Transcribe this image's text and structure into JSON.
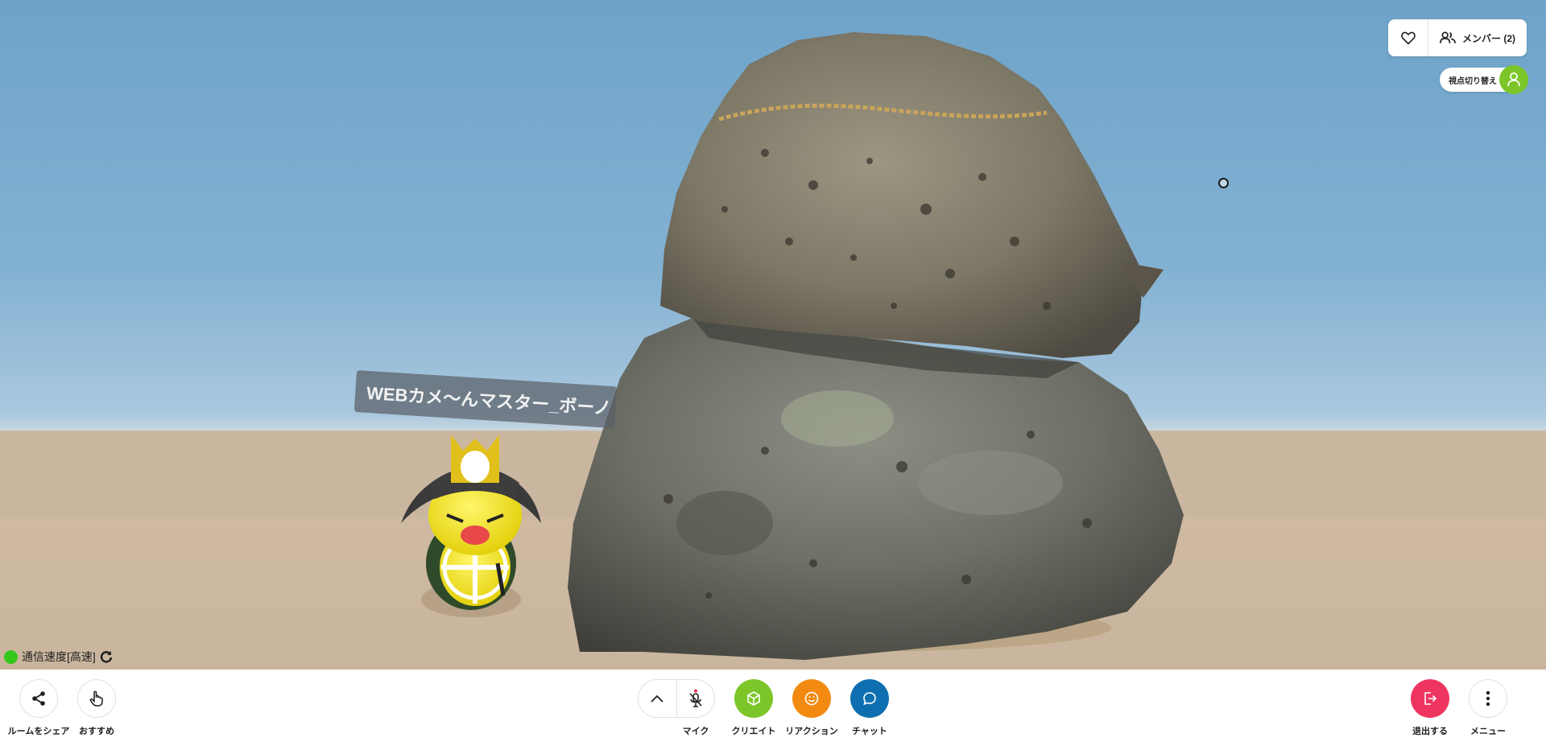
{
  "header": {
    "like_icon": "heart-icon",
    "members_label": "メンバー (2)",
    "members_icon": "users-icon",
    "view_switch_label": "視点切り替え",
    "view_switch_icon": "person-icon",
    "view_switch_color": "#7cc62a"
  },
  "scene": {
    "avatar_name": "WEBカメ〜んマスター_ボーノ"
  },
  "status": {
    "connection_label": "通信速度[高速]",
    "connection_color": "#35c71b",
    "refresh_icon": "refresh-icon"
  },
  "toolbar": {
    "share": {
      "label": "ルームをシェア",
      "icon": "share-icon"
    },
    "recommend": {
      "label": "おすすめ",
      "icon": "hand-pointer-icon"
    },
    "expand_icon": "chevron-up-icon",
    "mic": {
      "label": "マイク",
      "icon": "mic-off-icon",
      "indicator_color": "#e8334a"
    },
    "create": {
      "label": "クリエイト",
      "icon": "cube-icon",
      "color": "#7cc62a"
    },
    "reaction": {
      "label": "リアクション",
      "icon": "smile-icon",
      "color": "#f28a12"
    },
    "chat": {
      "label": "チャット",
      "icon": "chat-bubble-icon",
      "color": "#0e6fb0"
    },
    "exit": {
      "label": "退出する",
      "icon": "exit-icon",
      "color": "#ee3560"
    },
    "menu": {
      "label": "メニュー",
      "icon": "more-vertical-icon"
    }
  }
}
